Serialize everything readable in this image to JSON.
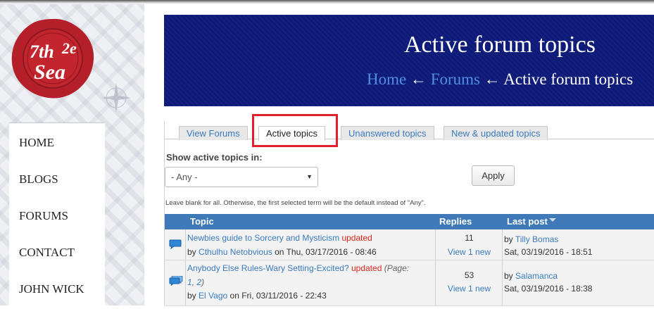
{
  "logo": {
    "text_line1": "7th",
    "text_line2": "Sea",
    "text_edition": "2e"
  },
  "nav": {
    "items": [
      {
        "label": "HOME"
      },
      {
        "label": "BLOGS"
      },
      {
        "label": "FORUMS"
      },
      {
        "label": "CONTACT"
      },
      {
        "label": "JOHN WICK"
      }
    ]
  },
  "header": {
    "title": "Active forum topics",
    "breadcrumb": [
      {
        "label": "Home"
      },
      {
        "label": "Forums"
      },
      {
        "label": "Active forum topics"
      }
    ],
    "separator": "←"
  },
  "tabs": [
    {
      "label": "View Forums",
      "active": false
    },
    {
      "label": "Active topics",
      "active": true
    },
    {
      "label": "Unanswered topics",
      "active": false
    },
    {
      "label": "New & updated topics",
      "active": false
    }
  ],
  "filter": {
    "label": "Show active topics in:",
    "selected": "- Any -",
    "apply_label": "Apply",
    "hint": "Leave blank for all. Otherwise, the first selected term will be the default instead of \"Any\"."
  },
  "table": {
    "headers": {
      "topic": "Topic",
      "replies": "Replies",
      "last_post": "Last post"
    },
    "rows": [
      {
        "title": "Newbies guide to Sorcery and Mysticism",
        "status": "updated",
        "pages_label": "",
        "by_label": "by",
        "author": "Cthulhu Netobvious",
        "on_label": "on",
        "date": "Thu, 03/17/2016 - 08:46",
        "replies": "11",
        "new_label": "View 1 new",
        "last_by_label": "by",
        "last_author": "Tilly Bomas",
        "last_date": "Sat, 03/19/2016 - 18:51"
      },
      {
        "title": "Anybody Else Rules-Wary Setting-Excited?",
        "status": "updated",
        "pages_label": "(Page:",
        "page1": "1",
        "page_sep": ",",
        "page2": "2",
        "pages_close": ")",
        "by_label": "by",
        "author": "El Vago",
        "on_label": "on",
        "date": "Fri, 03/11/2016 - 22:43",
        "replies": "53",
        "new_label": "View 1 new",
        "last_by_label": "by",
        "last_author": "Salamanca",
        "last_date": "Sat, 03/19/2016 - 18:38"
      }
    ]
  },
  "colors": {
    "banner": "#0d1a78",
    "table_header": "#3f79b7",
    "link": "#3b7bbf",
    "updated": "#d8261d",
    "highlight": "#e0202a",
    "seal": "#b51f2a"
  }
}
